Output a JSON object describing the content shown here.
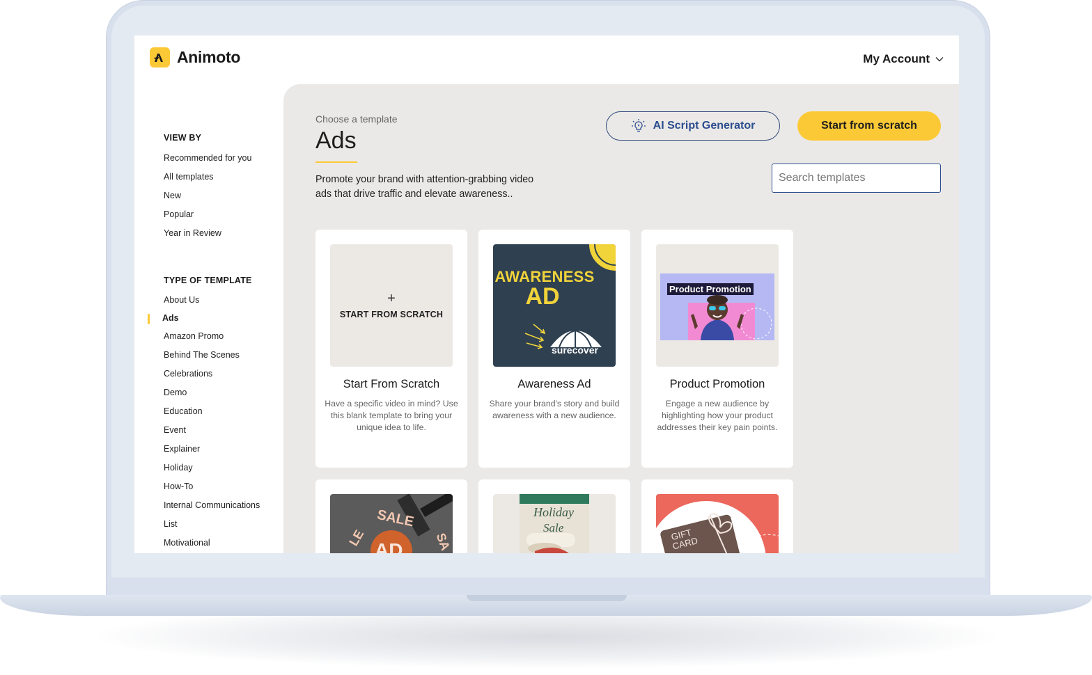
{
  "app": {
    "name": "Animoto"
  },
  "header": {
    "account_label": "My Account"
  },
  "sidebar": {
    "view_by_heading": "VIEW BY",
    "view_by": [
      "Recommended for you",
      "All templates",
      "New",
      "Popular",
      "Year in Review"
    ],
    "type_heading": "TYPE OF TEMPLATE",
    "types": [
      "About Us",
      "Ads",
      "Amazon Promo",
      "Behind The Scenes",
      "Celebrations",
      "Demo",
      "Education",
      "Event",
      "Explainer",
      "Holiday",
      "How-To",
      "Internal Communications",
      "List",
      "Motivational"
    ],
    "active_type": "Ads"
  },
  "main": {
    "kicker": "Choose a template",
    "title": "Ads",
    "description": "Promote your brand with attention-grabbing video ads that drive traffic and elevate awareness..",
    "ai_button": "AI Script Generator",
    "scratch_button": "Start from scratch",
    "search_placeholder": "Search templates"
  },
  "cards": [
    {
      "title": "Start From Scratch",
      "desc": "Have a specific video in mind? Use this blank template to bring your unique idea to life.",
      "thumb_plus": "+",
      "thumb_label": "START FROM SCRATCH"
    },
    {
      "title": "Awareness Ad",
      "desc": "Share your brand's story and build awareness with a new audience.",
      "thumb_line1": "AWARENESS",
      "thumb_line2": "AD",
      "thumb_brand": "surecover"
    },
    {
      "title": "Product Promotion",
      "desc": "Engage a new audience by highlighting how your product addresses their key pain points.",
      "thumb_tag": "Product Promotion"
    },
    {
      "thumb_word1": "SALE",
      "thumb_word2": "AD"
    },
    {
      "thumb_line1": "Holiday",
      "thumb_line2": "Sale"
    },
    {
      "thumb_line1": "GIFT",
      "thumb_line2": "CARD"
    }
  ],
  "colors": {
    "accent": "#fcc936",
    "navy": "#2b4d8f",
    "panel": "#ebe9e7"
  }
}
